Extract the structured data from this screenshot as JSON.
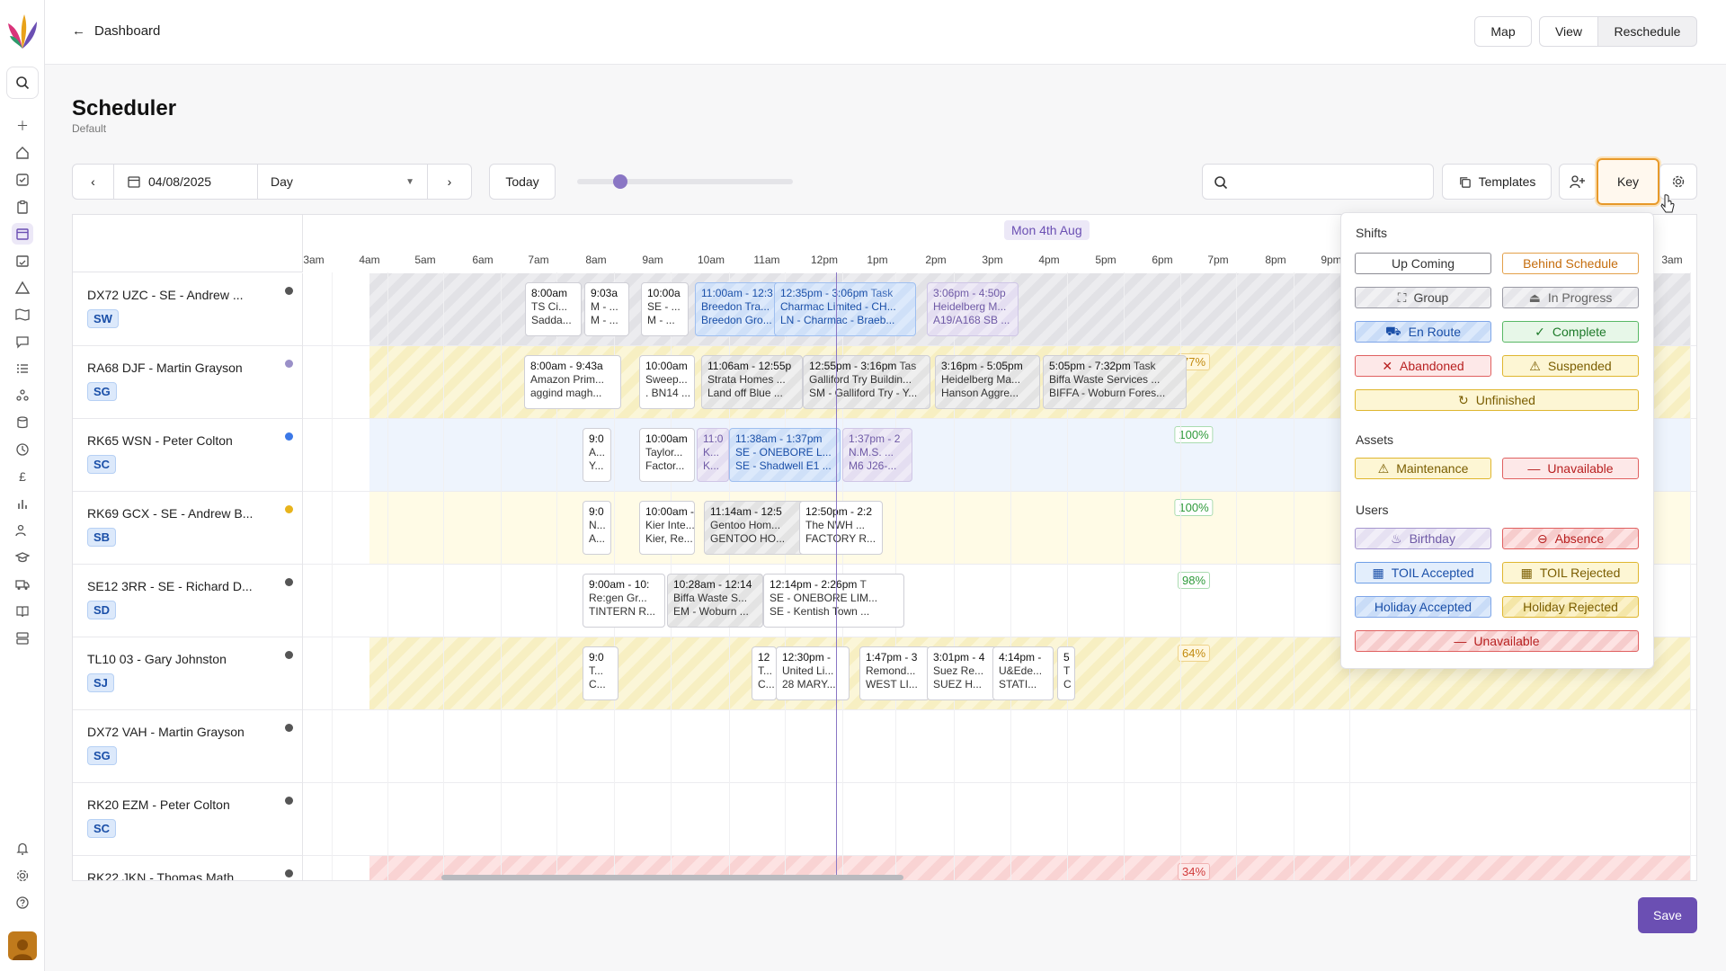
{
  "header": {
    "back_label": "Dashboard",
    "map_label": "Map",
    "view_label": "View",
    "reschedule_label": "Reschedule"
  },
  "page": {
    "title": "Scheduler",
    "subtitle": "Default"
  },
  "toolbar": {
    "date_value": "04/08/2025",
    "view_mode": "Day",
    "today_label": "Today",
    "zoom_level": 0.2,
    "search_placeholder": "",
    "templates_label": "Templates",
    "key_label": "Key"
  },
  "timeline": {
    "date_label": "Mon 4th Aug",
    "hours": [
      "3am",
      "4am",
      "5am",
      "6am",
      "7am",
      "8am",
      "9am",
      "10am",
      "11am",
      "12pm",
      "1pm",
      "2pm",
      "3pm",
      "4pm",
      "5pm",
      "6pm",
      "7pm",
      "8pm",
      "9pm",
      "3am"
    ]
  },
  "rows": [
    {
      "name": "DX72 UZC - SE - Andrew ...",
      "badge": "SW",
      "dot": "#555555",
      "pct": ""
    },
    {
      "name": "RA68 DJF - Martin Grayson",
      "badge": "SG",
      "dot": "#9a90c8",
      "pct": "77%"
    },
    {
      "name": "RK65 WSN - Peter Colton",
      "badge": "SC",
      "dot": "#3b78e7",
      "pct": "100%"
    },
    {
      "name": "RK69 GCX - SE - Andrew B...",
      "badge": "SB",
      "dot": "#e8b41c",
      "pct": "100%"
    },
    {
      "name": "SE12 3RR - SE - Richard D...",
      "badge": "SD",
      "dot": "#555555",
      "pct": "98%"
    },
    {
      "name": "TL10 03 - Gary Johnston",
      "badge": "SJ",
      "dot": "#555555",
      "pct": "64%"
    },
    {
      "name": "DX72 VAH - Martin Grayson",
      "badge": "SG",
      "dot": "#555555",
      "pct": ""
    },
    {
      "name": "RK20 EZM - Peter Colton",
      "badge": "SC",
      "dot": "#555555",
      "pct": ""
    },
    {
      "name": "RK22 JKN - Thomas Math...",
      "badge": "",
      "dot": "#555555",
      "pct": "34%"
    }
  ],
  "cards": [
    {
      "row": 0,
      "h1": "8:00am",
      "h2": "TS Ci...",
      "h3": "Sadda...",
      "style": "plain"
    },
    {
      "row": 0,
      "h1": "9:03a",
      "h2": "M - ...",
      "h3": "M - ...",
      "style": "plain"
    },
    {
      "row": 0,
      "h1": "10:00a",
      "h2": "SE - ...",
      "h3": "M - ...",
      "style": "plain"
    },
    {
      "row": 0,
      "h1": "11:00am - 12:3",
      "h2": "Breedon Tra...",
      "h3": "Breedon Gro...",
      "style": "blue"
    },
    {
      "row": 0,
      "h1": "12:35pm - 3:06pm",
      "tag": "Task",
      "h2": "Charmac Limited - CH...",
      "h3": "LN - Charmac - Braeb...",
      "style": "blue"
    },
    {
      "row": 0,
      "h1": "3:06pm - 4:50p",
      "h2": "Heidelberg M...",
      "h3": "A19/A168 SB ...",
      "style": "violet"
    },
    {
      "row": 1,
      "h1": "8:00am - 9:43a",
      "h2": "Amazon Prim...",
      "h3": "aggind magh...",
      "style": "plain"
    },
    {
      "row": 1,
      "h1": "10:00am",
      "h2": "Sweep...",
      "h3": ". BN14 ...",
      "style": "plain"
    },
    {
      "row": 1,
      "h1": "11:06am - 12:55p",
      "h2": "Strata Homes ...",
      "h3": "Land off Blue ...",
      "style": "grey"
    },
    {
      "row": 1,
      "h1": "12:55pm - 3:16pm",
      "tag": "Tas",
      "h2": "Galliford Try Buildin...",
      "h3": "SM - Galliford Try - Y...",
      "style": "grey"
    },
    {
      "row": 1,
      "h1": "3:16pm - 5:05pm",
      "h2": "Heidelberg Ma...",
      "h3": "Hanson Aggre...",
      "style": "grey"
    },
    {
      "row": 1,
      "h1": "5:05pm - 7:32pm",
      "tag": "Task",
      "h2": "Biffa Waste Services ...",
      "h3": "BIFFA - Woburn Fores...",
      "style": "grey"
    },
    {
      "row": 2,
      "h1": "9:0",
      "h2": "A...",
      "h3": "Y...",
      "style": "plain"
    },
    {
      "row": 2,
      "h1": "10:00am",
      "h2": "Taylor...",
      "h3": "Factor...",
      "style": "plain"
    },
    {
      "row": 2,
      "h1": "11:0",
      "h2": "K...",
      "h3": "K...",
      "style": "violet"
    },
    {
      "row": 2,
      "h1": "11:38am - 1:37pm",
      "h2": "SE - ONEBORE L...",
      "h3": "SE - Shadwell E1 ...",
      "style": "blue"
    },
    {
      "row": 2,
      "h1": "1:37pm - 2",
      "h2": "N.M.S. ...",
      "h3": "M6 J26-...",
      "style": "violet"
    },
    {
      "row": 3,
      "h1": "9:0",
      "h2": "N...",
      "h3": "A...",
      "style": "plain"
    },
    {
      "row": 3,
      "h1": "10:00am -",
      "h2": "Kier Inte...",
      "h3": "Kier, Re...",
      "style": "plain"
    },
    {
      "row": 3,
      "h1": "11:14am - 12:5",
      "h2": "Gentoo Hom...",
      "h3": "GENTOO HO...",
      "style": "grey"
    },
    {
      "row": 3,
      "h1": "12:50pm - 2:2",
      "h2": "The NWH ...",
      "h3": "FACTORY R...",
      "style": "plain"
    },
    {
      "row": 4,
      "h1": "9:00am - 10:",
      "h2": "Re:gen Gr...",
      "h3": "TINTERN R...",
      "style": "plain"
    },
    {
      "row": 4,
      "h1": "10:28am - 12:14",
      "h2": "Biffa Waste S...",
      "h3": "EM - Woburn ...",
      "style": "grey"
    },
    {
      "row": 4,
      "h1": "12:14pm - 2:26pm",
      "tag": "T",
      "h2": "SE - ONEBORE LIM...",
      "h3": "SE - Kentish Town ...",
      "style": "plain"
    },
    {
      "row": 5,
      "h1": "9:0",
      "h2": "T...",
      "h3": "C...",
      "style": "plain"
    },
    {
      "row": 5,
      "h1": "12",
      "h2": "T...",
      "h3": "C...",
      "style": "plain"
    },
    {
      "row": 5,
      "h1": "12:30pm -",
      "h2": "United Li...",
      "h3": "28 MARY...",
      "style": "plain"
    },
    {
      "row": 5,
      "h1": "1:47pm - 3",
      "h2": "Remond...",
      "h3": "WEST LI...",
      "style": "plain"
    },
    {
      "row": 5,
      "h1": "3:01pm - 4",
      "h2": "Suez Re...",
      "h3": "SUEZ H...",
      "style": "plain"
    },
    {
      "row": 5,
      "h1": "4:14pm -",
      "h2": "U&Ede...",
      "h3": "STATI...",
      "style": "plain"
    },
    {
      "row": 5,
      "h1": "5",
      "h2": "T",
      "h3": "C",
      "style": "plain"
    }
  ],
  "key": {
    "shifts_title": "Shifts",
    "assets_title": "Assets",
    "users_title": "Users",
    "shifts": {
      "upcoming": "Up Coming",
      "behind": "Behind Schedule",
      "group": "Group",
      "in_progress": "In Progress",
      "en_route": "En Route",
      "complete": "Complete",
      "abandoned": "Abandoned",
      "suspended": "Suspended",
      "unfinished": "Unfinished"
    },
    "assets": {
      "maintenance": "Maintenance",
      "unavailable": "Unavailable"
    },
    "users": {
      "birthday": "Birthday",
      "absence": "Absence",
      "toil_accepted": "TOIL Accepted",
      "toil_rejected": "TOIL Rejected",
      "holiday_accepted": "Holiday Accepted",
      "holiday_rejected": "Holiday Rejected",
      "unavailable": "Unavailable"
    }
  },
  "footer": {
    "save_label": "Save"
  }
}
